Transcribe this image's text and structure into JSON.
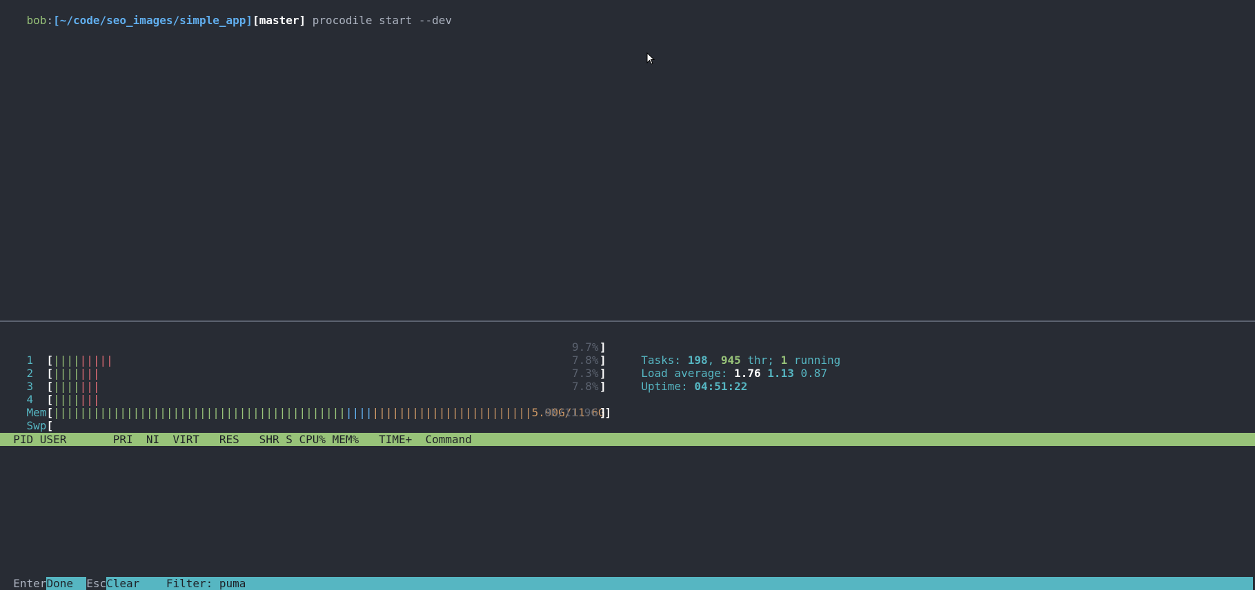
{
  "prompt": {
    "user": "bob",
    "sep": ":",
    "path": "[~/code/seo_images/simple_app]",
    "branch": "[master]",
    "command": " procodile start --dev"
  },
  "meters": {
    "cpus": [
      {
        "label": "1",
        "green": "||||",
        "red": "|||||",
        "pct": "9.7%"
      },
      {
        "label": "2",
        "green": "||||",
        "red": "|||",
        "pct": "7.8%"
      },
      {
        "label": "3",
        "green": "||||",
        "red": "|||",
        "pct": "7.3%"
      },
      {
        "label": "4",
        "green": "||||",
        "red": "|||",
        "pct": "7.8%"
      }
    ],
    "mem": {
      "label": "Mem",
      "green": "||||||||||||||||||||||||||||||||||||||||||||",
      "blue": "||||",
      "orange": "||||||||||||||||||||||||",
      "value": "5.90G/11.6G"
    },
    "swp": {
      "label": "Swp",
      "value": "0K/11.9G"
    }
  },
  "stats": {
    "tasks_label": "Tasks: ",
    "tasks": "198",
    "comma": ", ",
    "threads": "945",
    "thr_label": " thr; ",
    "running": "1",
    "running_label": " running",
    "load_label": "Load average: ",
    "load1": "1.76",
    "load5": "1.13",
    "load15": "0.87",
    "uptime_label": "Uptime: ",
    "uptime": "04:51:22"
  },
  "table": {
    "header": "  PID USER       PRI  NI  VIRT   RES   SHR S CPU% MEM%   TIME+  Command"
  },
  "footer": {
    "enter_key": "Enter",
    "done": "Done  ",
    "esc_key": "Esc",
    "clear": "Clear  ",
    "filter": "  Filter: puma"
  },
  "colors": {
    "background": "#282c34",
    "green": "#98c379",
    "blue": "#61afef",
    "cyan": "#56b6c2",
    "red": "#e06c75",
    "orange": "#d19a66"
  }
}
